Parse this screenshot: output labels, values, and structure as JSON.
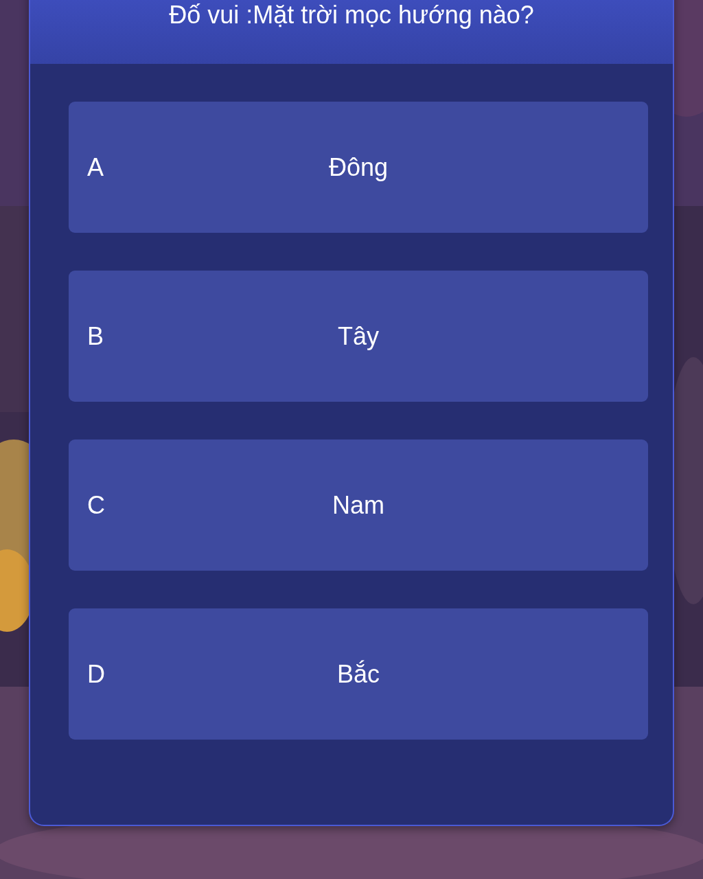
{
  "quiz": {
    "question": "Đố vui :Mặt trời mọc hướng nào?",
    "answers": [
      {
        "letter": "A",
        "text": "Đông"
      },
      {
        "letter": "B",
        "text": "Tây"
      },
      {
        "letter": "C",
        "text": "Nam"
      },
      {
        "letter": "D",
        "text": "Bắc"
      }
    ]
  }
}
